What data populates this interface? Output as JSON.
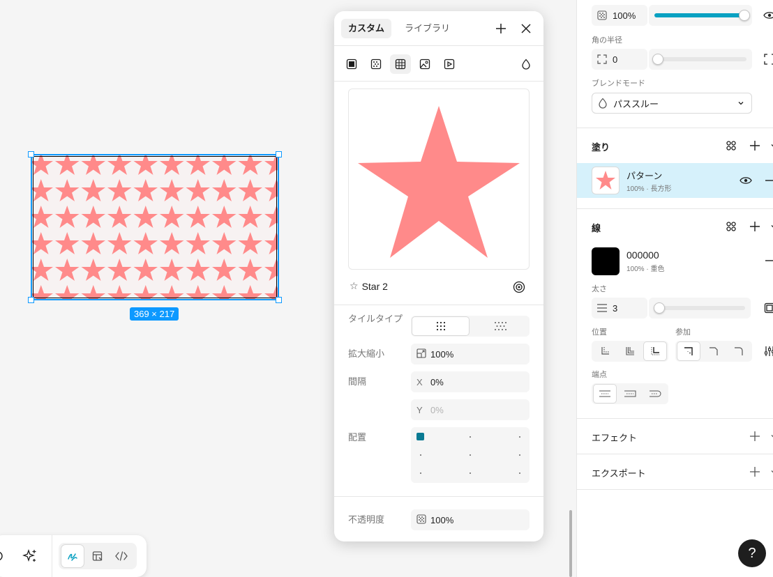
{
  "canvas": {
    "dimension_badge": "369 × 217",
    "pattern_color": "#ff8a8a",
    "selection_color": "#0d99ff"
  },
  "bottom_toolbar": {
    "tools": [
      "refresh-icon",
      "ai-sparkle-icon",
      "draw-icon",
      "design-icon",
      "code-icon"
    ]
  },
  "popup": {
    "tabs": [
      {
        "label": "カスタム",
        "active": true
      },
      {
        "label": "ライブラリ",
        "active": false
      }
    ],
    "fill_types": [
      "solid-icon",
      "gradient-icon",
      "pattern-icon",
      "image-icon",
      "video-icon"
    ],
    "preview_name": "Star 2",
    "tile_type_label": "タイルタイプ",
    "scale_label": "拡大縮小",
    "scale_value": "100%",
    "spacing_label": "間隔",
    "spacing_x_prefix": "X",
    "spacing_x": "0%",
    "spacing_y_prefix": "Y",
    "spacing_y": "0%",
    "alignment_label": "配置",
    "opacity_label": "不透明度",
    "opacity_value": "100%"
  },
  "right_panel": {
    "layer_opacity": "100%",
    "layer_opacity_fraction": 0.98,
    "corner_radius_label": "角の半径",
    "corner_radius_value": "0",
    "blend_mode_label": "ブレンドモード",
    "blend_mode_value": "パススルー",
    "fill_section_title": "塗り",
    "fill_item_name": "パターン",
    "fill_item_sub": "100% · 長方形",
    "stroke_section_title": "線",
    "stroke_color_hex": "000000",
    "stroke_sub": "100% · 重色",
    "stroke_weight_label": "太さ",
    "stroke_weight_value": "3",
    "stroke_weight_fraction": 0.05,
    "position_label": "位置",
    "join_label": "参加",
    "cap_label": "端点",
    "effects_title": "エフェクト",
    "export_title": "エクスポート",
    "accent_color": "#0aa1c2",
    "fill_row_bg": "#d6f1fb"
  },
  "help_label": "?"
}
